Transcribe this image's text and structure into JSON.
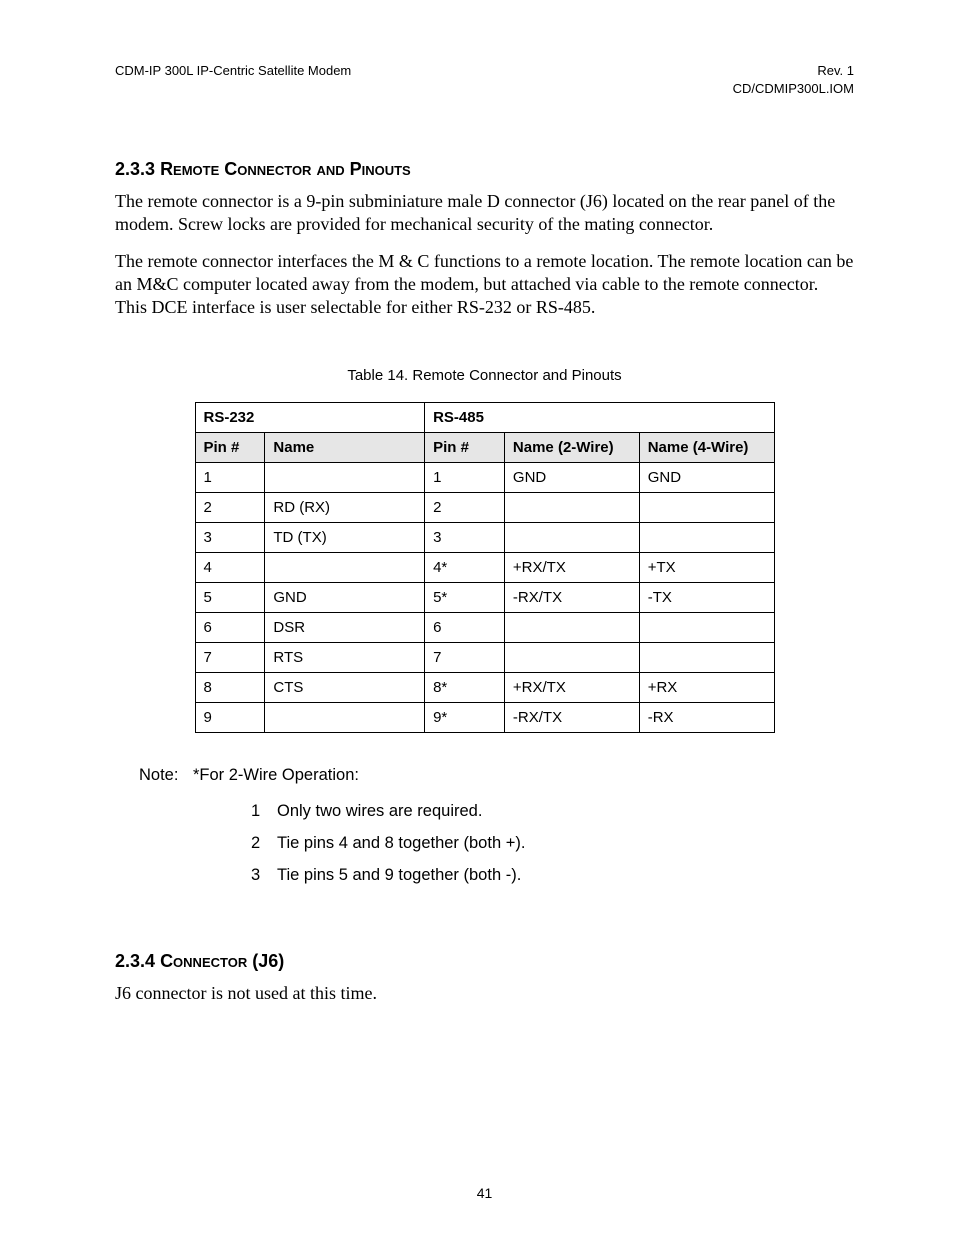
{
  "header": {
    "left": "CDM-IP 300L IP-Centric Satellite Modem",
    "right1": "Rev. 1",
    "right2": "CD/CDMIP300L.IOM"
  },
  "section233": {
    "number": "2.3.3",
    "title": "Remote Connector and Pinouts",
    "p1": "The remote connector is a 9-pin subminiature male D connector (J6) located on the rear panel of the modem. Screw locks are provided for mechanical security of the mating connector.",
    "p2": "The remote connector interfaces the M & C functions to a remote location. The remote location can be an M&C computer located away from the modem, but attached via cable to the remote connector. This DCE interface is user selectable for either RS-232 or RS-485."
  },
  "table": {
    "caption": "Table 14. Remote Connector and Pinouts",
    "group1": "RS-232",
    "group2": "RS-485",
    "headers": {
      "pin232": "Pin #",
      "name232": "Name",
      "pin485": "Pin #",
      "name2w": "Name (2-Wire)",
      "name4w": "Name (4-Wire)"
    },
    "rows": [
      {
        "p232": "1",
        "n232": "",
        "p485": "1",
        "n2": "GND",
        "n4": "GND"
      },
      {
        "p232": "2",
        "n232": "RD (RX)",
        "p485": "2",
        "n2": "",
        "n4": ""
      },
      {
        "p232": "3",
        "n232": "TD (TX)",
        "p485": "3",
        "n2": "",
        "n4": ""
      },
      {
        "p232": "4",
        "n232": "",
        "p485": "4*",
        "n2": "+RX/TX",
        "n4": "+TX"
      },
      {
        "p232": "5",
        "n232": "GND",
        "p485": "5*",
        "n2": "-RX/TX",
        "n4": "-TX"
      },
      {
        "p232": "6",
        "n232": "DSR",
        "p485": "6",
        "n2": "",
        "n4": ""
      },
      {
        "p232": "7",
        "n232": "RTS",
        "p485": "7",
        "n2": "",
        "n4": ""
      },
      {
        "p232": "8",
        "n232": "CTS",
        "p485": "8*",
        "n2": "+RX/TX",
        "n4": "+RX"
      },
      {
        "p232": "9",
        "n232": "",
        "p485": "9*",
        "n2": "-RX/TX",
        "n4": "-RX"
      }
    ]
  },
  "notes": {
    "label": "Note:",
    "lead": "*For 2-Wire Operation:",
    "items": [
      "Only two wires are required.",
      "Tie pins 4 and 8 together (both +).",
      "Tie pins 5 and 9 together (both -)."
    ]
  },
  "section234": {
    "number": "2.3.4",
    "title": "Connector (J6)",
    "p1": "J6 connector is not used at this time."
  },
  "pageNumber": "41"
}
